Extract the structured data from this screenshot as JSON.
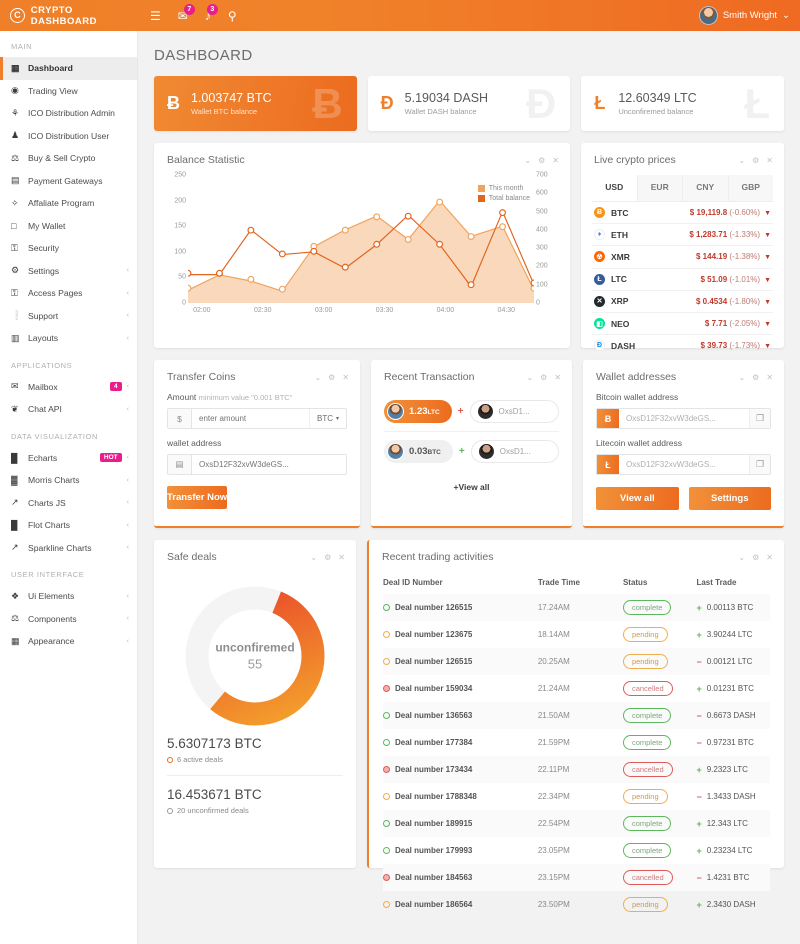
{
  "topbar": {
    "brand": "CRYPTO DASHBOARD",
    "brand_glyph": "C",
    "menu_icon": "☰",
    "mail_icon": "✉",
    "mail_badge": "7",
    "bell_icon": "♪",
    "bell_badge": "3",
    "search_icon": "⚲",
    "user_name": "Smith Wright",
    "user_caret": "⌄"
  },
  "sidebar": {
    "sections": [
      {
        "title": "MAIN",
        "items": [
          {
            "label": "Dashboard",
            "icon": "▦",
            "active": true
          },
          {
            "label": "Trading View",
            "icon": "◉"
          },
          {
            "label": "ICO Distribution Admin",
            "icon": "⚘"
          },
          {
            "label": "ICO Distribution User",
            "icon": "♟"
          },
          {
            "label": "Buy & Sell Crypto",
            "icon": "⚖"
          },
          {
            "label": "Payment Gateways",
            "icon": "▤"
          },
          {
            "label": "Affaliate Program",
            "icon": "✧"
          },
          {
            "label": "My Wallet",
            "icon": "□"
          },
          {
            "label": "Security",
            "icon": "⚿"
          },
          {
            "label": "Settings",
            "icon": "⚙",
            "chevron": "‹"
          },
          {
            "label": "Access Pages",
            "icon": "⚿",
            "chevron": "‹"
          },
          {
            "label": "Support",
            "icon": "❕",
            "chevron": "‹"
          },
          {
            "label": "Layouts",
            "icon": "▥",
            "chevron": "‹"
          }
        ]
      },
      {
        "title": "APPLICATIONS",
        "items": [
          {
            "label": "Mailbox",
            "icon": "✉",
            "badge": "4",
            "chevron": "‹"
          },
          {
            "label": "Chat API",
            "icon": "❦",
            "chevron": "‹"
          }
        ]
      },
      {
        "title": "DATA VISUALIZATION",
        "items": [
          {
            "label": "Echarts",
            "icon": "█",
            "badge": "HOT",
            "chevron": "‹"
          },
          {
            "label": "Morris Charts",
            "icon": "▓",
            "chevron": "‹"
          },
          {
            "label": "Charts JS",
            "icon": "↗",
            "chevron": "‹"
          },
          {
            "label": "Flot Charts",
            "icon": "█",
            "chevron": "‹"
          },
          {
            "label": "Sparkline Charts",
            "icon": "↗",
            "chevron": "‹"
          }
        ]
      },
      {
        "title": "USER INTERFACE",
        "items": [
          {
            "label": "Ui Elements",
            "icon": "❖",
            "chevron": "‹"
          },
          {
            "label": "Components",
            "icon": "⚖",
            "chevron": "‹"
          },
          {
            "label": "Appearance",
            "icon": "▦",
            "chevron": "‹"
          }
        ]
      }
    ]
  },
  "page": {
    "title": "DASHBOARD"
  },
  "stats": [
    {
      "icon": "Ƀ",
      "value": "1.003747 BTC",
      "sub": "Wallet BTC balance",
      "ghost": "Ƀ",
      "primary": true
    },
    {
      "icon": "Đ",
      "value": "5.19034 DASH",
      "sub": "Wallet DASH balance",
      "ghost": "Đ",
      "primary": false
    },
    {
      "icon": "Ł",
      "value": "12.60349 LTC",
      "sub": "Unconfiremed balance",
      "ghost": "Ł",
      "primary": false
    }
  ],
  "tools": {
    "collapse": "⌄",
    "settings": "⚙",
    "close": "✕"
  },
  "balance_card": {
    "title": "Balance Statistic"
  },
  "chart_data": {
    "type": "area",
    "title": "Balance Statistic",
    "xlabel": "",
    "ylabel": "",
    "grid": false,
    "legend_position": "top-right",
    "x": [
      "02:00",
      "02:10",
      "02:30",
      "02:45",
      "03:00",
      "03:15",
      "03:35",
      "03:50",
      "04:05",
      "04:25",
      "04:40",
      "04:55"
    ],
    "xticks": [
      "02:00",
      "02:30",
      "03:00",
      "03:30",
      "04:00",
      "04:30"
    ],
    "ylim": [
      0,
      250
    ],
    "yticks": [
      0,
      50,
      100,
      150,
      200,
      250
    ],
    "y2lim": [
      0,
      700
    ],
    "y2ticks": [
      0,
      100,
      200,
      300,
      400,
      500,
      600,
      700
    ],
    "series": [
      {
        "name": "This month",
        "color": "#f0a35c",
        "axis": "left",
        "type": "area",
        "values": [
          25,
          55,
          43,
          23,
          110,
          143,
          170,
          124,
          200,
          130,
          150,
          25
        ]
      },
      {
        "name": "Total balance",
        "color": "#e2641e",
        "axis": "right",
        "type": "line",
        "values": [
          155,
          155,
          400,
          265,
          280,
          190,
          320,
          480,
          320,
          90,
          500,
          100
        ]
      }
    ]
  },
  "live_prices": {
    "title": "Live crypto prices",
    "tabs": [
      "USD",
      "EUR",
      "CNY",
      "GBP"
    ],
    "active_tab": "USD",
    "arrow": "▼",
    "rows": [
      {
        "symbol": "BTC",
        "glyph": "Ƀ",
        "color": "#f7931a",
        "price": "$ 19,119.8",
        "change": "(-0.60%)"
      },
      {
        "symbol": "ETH",
        "glyph": "♦",
        "color": "#ffffff",
        "text_color": "#627eea",
        "price": "$ 1,283.71",
        "change": "(-1.33%)"
      },
      {
        "symbol": "XMR",
        "glyph": "☢",
        "color": "#ff6600",
        "price": "$ 144.19",
        "change": "(-1.38%)"
      },
      {
        "symbol": "LTC",
        "glyph": "Ł",
        "color": "#345d9d",
        "price": "$ 51.09",
        "change": "(-1.01%)"
      },
      {
        "symbol": "XRP",
        "glyph": "✕",
        "color": "#23292f",
        "price": "$ 0.4534",
        "change": "(-1.80%)"
      },
      {
        "symbol": "NEO",
        "glyph": "◧",
        "color": "#00e599",
        "price": "$ 7.71",
        "change": "(-2.05%)"
      },
      {
        "symbol": "DASH",
        "glyph": "Đ",
        "color": "#ffffff",
        "text_color": "#008ce7",
        "price": "$ 39.73",
        "change": "(-1.73%)"
      }
    ]
  },
  "transfer": {
    "title": "Transfer Coins",
    "amount_label": "Amount",
    "amount_hint": "minimum value \"0.001 BTC\"",
    "currency_symbol": "$",
    "amount_placeholder": "enter amount",
    "coin_selected": "BTC",
    "coin_caret": "▾",
    "wallet_label": "wallet address",
    "wallet_icon": "▤",
    "wallet_placeholder": "OxsD12F32xvW3deGS...",
    "submit_label": "Transfer Now"
  },
  "recent_transaction": {
    "title": "Recent Transaction",
    "items": [
      {
        "amount": "1.23",
        "unit": "LTC",
        "plus": "+",
        "dest": "OxsD1...",
        "highlight": true
      },
      {
        "amount": "0.03",
        "unit": "BTC",
        "plus": "+",
        "dest": "OxsD1...",
        "highlight": false
      }
    ],
    "view_all": "+View all"
  },
  "wallet_addresses": {
    "title": "Wallet addresses",
    "copy_icon": "❐",
    "fields": [
      {
        "label": "Bitcoin wallet address",
        "icon": "Ƀ",
        "value": "OxsD12F32xvW3deGS..."
      },
      {
        "label": "Litecoin wallet address",
        "icon": "Ł",
        "value": "OxsD12F32xvW3deGS..."
      }
    ],
    "view_all_label": "View all",
    "settings_label": "Settings"
  },
  "safe_deals": {
    "title": "Safe deals",
    "donut_label": "unconfiremed",
    "donut_value": "55",
    "percent": 55,
    "active_amount": "5.6307173 BTC",
    "active_sub": "6 active deals",
    "unconfirmed_amount": "16.453671 BTC",
    "unconfirmed_sub": "20 unconfirmed deals"
  },
  "trading": {
    "title": "Recent trading activities",
    "columns": [
      "Deal ID Number",
      "Trade Time",
      "Status",
      "Last Trade"
    ],
    "rows": [
      {
        "deal": "Deal number 126515",
        "time": "17.24AM",
        "status": "complete",
        "sign": "+",
        "trade": "0.00113 BTC",
        "dir": "up"
      },
      {
        "deal": "Deal number 123675",
        "time": "18.14AM",
        "status": "pending",
        "sign": "+",
        "trade": "3.90244 LTC",
        "dir": "up"
      },
      {
        "deal": "Deal number 126515",
        "time": "20.25AM",
        "status": "pending",
        "sign": "−",
        "trade": "0.00121 LTC",
        "dir": "down"
      },
      {
        "deal": "Deal number 159034",
        "time": "21.24AM",
        "status": "cancelled",
        "sign": "+",
        "trade": "0.01231 BTC",
        "dir": "up"
      },
      {
        "deal": "Deal number 136563",
        "time": "21.50AM",
        "status": "complete",
        "sign": "−",
        "trade": "0.6673 DASH",
        "dir": "down"
      },
      {
        "deal": "Deal number 177384",
        "time": "21.59PM",
        "status": "complete",
        "sign": "−",
        "trade": "0.97231 BTC",
        "dir": "down"
      },
      {
        "deal": "Deal number 173434",
        "time": "22.11PM",
        "status": "cancelled",
        "sign": "+",
        "trade": "9.2323 LTC",
        "dir": "up"
      },
      {
        "deal": "Deal number 1788348",
        "time": "22.34PM",
        "status": "pending",
        "sign": "−",
        "trade": "1.3433 DASH",
        "dir": "down"
      },
      {
        "deal": "Deal number 189915",
        "time": "22.54PM",
        "status": "complete",
        "sign": "+",
        "trade": "12.343 LTC",
        "dir": "up"
      },
      {
        "deal": "Deal number 179993",
        "time": "23.05PM",
        "status": "complete",
        "sign": "+",
        "trade": "0.23234 LTC",
        "dir": "up"
      },
      {
        "deal": "Deal number 184563",
        "time": "23.15PM",
        "status": "cancelled",
        "sign": "−",
        "trade": "1.4231 BTC",
        "dir": "down"
      },
      {
        "deal": "Deal number 186564",
        "time": "23.50PM",
        "status": "pending",
        "sign": "+",
        "trade": "2.3430 DASH",
        "dir": "up"
      }
    ]
  },
  "colors": {
    "accent": "#ef7f28",
    "accent_dark": "#ec6b1f",
    "badge": "#e91e8c",
    "down": "#c0392b"
  }
}
